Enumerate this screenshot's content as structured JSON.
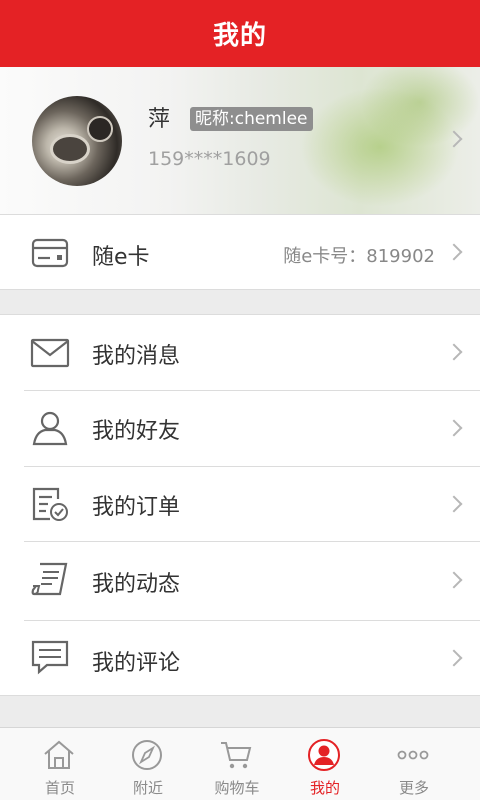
{
  "header": {
    "title": "我的"
  },
  "profile": {
    "name": "萍",
    "nickname": "昵称:chemlee",
    "phone": "159****1609"
  },
  "ecard": {
    "label": "随e卡",
    "number_text": "随e卡号：819902"
  },
  "menu": [
    {
      "label": "我的消息",
      "icon": "envelope-icon"
    },
    {
      "label": "我的好友",
      "icon": "person-icon"
    },
    {
      "label": "我的订单",
      "icon": "order-check-icon"
    },
    {
      "label": "我的动态",
      "icon": "scroll-icon"
    },
    {
      "label": "我的评论",
      "icon": "comment-icon"
    }
  ],
  "tabs": [
    {
      "label": "首页",
      "icon": "home-icon"
    },
    {
      "label": "附近",
      "icon": "compass-icon"
    },
    {
      "label": "购物车",
      "icon": "cart-icon"
    },
    {
      "label": "我的",
      "icon": "user-icon"
    },
    {
      "label": "更多",
      "icon": "more-dots-icon"
    }
  ],
  "colors": {
    "brand": "#e42225",
    "active_tab": "#e42225"
  }
}
